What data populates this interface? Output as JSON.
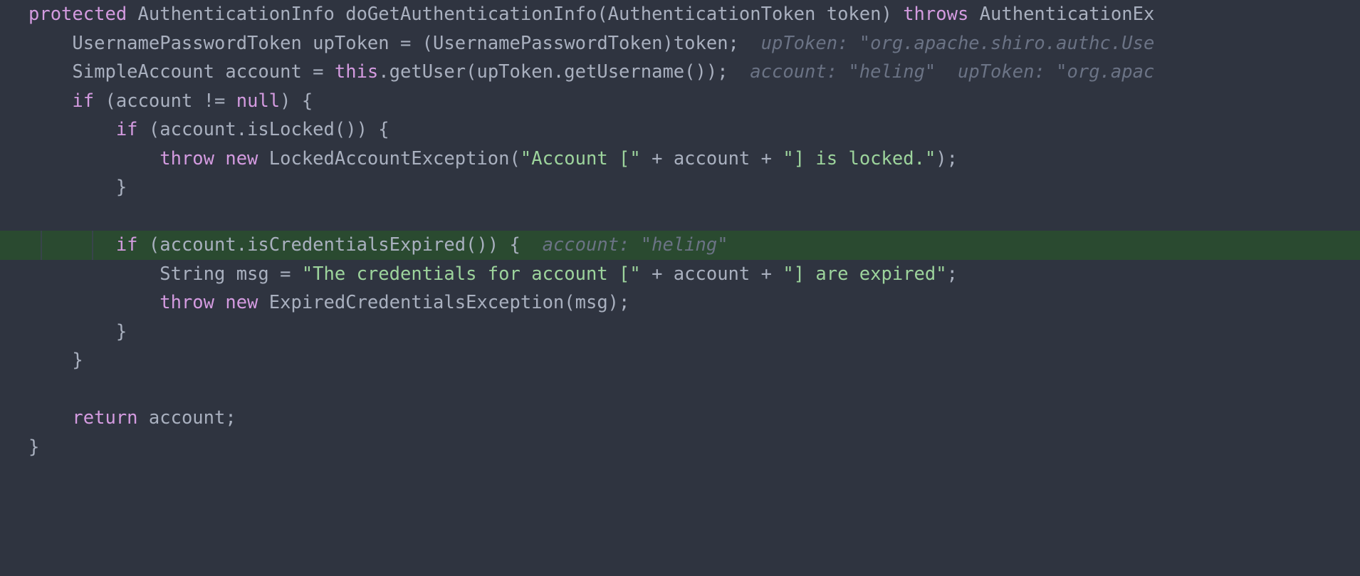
{
  "editor": {
    "name": "code-editor",
    "language": "Java",
    "theme": {
      "background": "#2f3440",
      "foreground": "#a9b0bf",
      "keyword": "#d49be0",
      "string": "#9dd49c",
      "debug_hint": "#6b7385",
      "execution_line_highlight": "#2a4a30",
      "indent_guide": "#3b4350"
    },
    "font_size_px": 25.5,
    "line_height_px": 40.5,
    "clipped_right_edge": true
  },
  "code": {
    "lines": [
      {
        "id": "line-1",
        "indent": 0,
        "highlighted": false,
        "tokens": [
          {
            "type": "keyword",
            "text": "protected"
          },
          {
            "type": "plain",
            "text": " AuthenticationInfo doGetAuthenticationInfo(AuthenticationToken token) "
          },
          {
            "type": "keyword",
            "text": "throws"
          },
          {
            "type": "plain",
            "text": " AuthenticationEx"
          }
        ]
      },
      {
        "id": "line-2",
        "indent": 1,
        "highlighted": false,
        "tokens": [
          {
            "type": "plain",
            "text": "    UsernamePasswordToken upToken = (UsernamePasswordToken)token;"
          },
          {
            "type": "hint",
            "text": "  upToken: \"org.apache.shiro.authc.Use"
          }
        ]
      },
      {
        "id": "line-3",
        "indent": 1,
        "highlighted": false,
        "tokens": [
          {
            "type": "plain",
            "text": "    SimpleAccount account = "
          },
          {
            "type": "keyword",
            "text": "this"
          },
          {
            "type": "plain",
            "text": ".getUser(upToken.getUsername());"
          },
          {
            "type": "hint",
            "text": "  account: \"heling\"  upToken: \"org.apac"
          }
        ]
      },
      {
        "id": "line-4",
        "indent": 1,
        "highlighted": false,
        "tokens": [
          {
            "type": "plain",
            "text": "    "
          },
          {
            "type": "keyword",
            "text": "if"
          },
          {
            "type": "plain",
            "text": " (account != "
          },
          {
            "type": "keyword",
            "text": "null"
          },
          {
            "type": "plain",
            "text": ") {"
          }
        ]
      },
      {
        "id": "line-5",
        "indent": 2,
        "highlighted": false,
        "tokens": [
          {
            "type": "plain",
            "text": "        "
          },
          {
            "type": "keyword",
            "text": "if"
          },
          {
            "type": "plain",
            "text": " (account.isLocked()) {"
          }
        ]
      },
      {
        "id": "line-6",
        "indent": 3,
        "highlighted": false,
        "tokens": [
          {
            "type": "plain",
            "text": "            "
          },
          {
            "type": "keyword",
            "text": "throw new"
          },
          {
            "type": "plain",
            "text": " LockedAccountException("
          },
          {
            "type": "str",
            "text": "\"Account [\""
          },
          {
            "type": "plain",
            "text": " + account + "
          },
          {
            "type": "str",
            "text": "\"] is locked.\""
          },
          {
            "type": "plain",
            "text": ");"
          }
        ]
      },
      {
        "id": "line-7",
        "indent": 2,
        "highlighted": false,
        "tokens": [
          {
            "type": "plain",
            "text": "        }"
          }
        ]
      },
      {
        "id": "line-8",
        "indent": 0,
        "highlighted": false,
        "tokens": [
          {
            "type": "plain",
            "text": ""
          }
        ]
      },
      {
        "id": "line-9",
        "indent": 2,
        "highlighted": true,
        "tokens": [
          {
            "type": "plain",
            "text": "        "
          },
          {
            "type": "keyword",
            "text": "if"
          },
          {
            "type": "plain",
            "text": " (account.isCredentialsExpired()) {"
          },
          {
            "type": "hint",
            "text": "  account: \"heling\""
          }
        ]
      },
      {
        "id": "line-10",
        "indent": 3,
        "highlighted": false,
        "tokens": [
          {
            "type": "plain",
            "text": "            String msg = "
          },
          {
            "type": "str",
            "text": "\"The credentials for account [\""
          },
          {
            "type": "plain",
            "text": " + account + "
          },
          {
            "type": "str",
            "text": "\"] are expired\""
          },
          {
            "type": "plain",
            "text": ";"
          }
        ]
      },
      {
        "id": "line-11",
        "indent": 3,
        "highlighted": false,
        "tokens": [
          {
            "type": "plain",
            "text": "            "
          },
          {
            "type": "keyword",
            "text": "throw new"
          },
          {
            "type": "plain",
            "text": " ExpiredCredentialsException(msg);"
          }
        ]
      },
      {
        "id": "line-12",
        "indent": 2,
        "highlighted": false,
        "tokens": [
          {
            "type": "plain",
            "text": "        }"
          }
        ]
      },
      {
        "id": "line-13",
        "indent": 1,
        "highlighted": false,
        "tokens": [
          {
            "type": "plain",
            "text": "    }"
          }
        ]
      },
      {
        "id": "line-14",
        "indent": 0,
        "highlighted": false,
        "tokens": [
          {
            "type": "plain",
            "text": ""
          }
        ]
      },
      {
        "id": "line-15",
        "indent": 1,
        "highlighted": false,
        "tokens": [
          {
            "type": "keyword",
            "text": "    return"
          },
          {
            "type": "plain",
            "text": " account;"
          }
        ]
      },
      {
        "id": "line-16",
        "indent": 0,
        "highlighted": false,
        "tokens": [
          {
            "type": "plain",
            "text": "}"
          }
        ]
      }
    ]
  }
}
